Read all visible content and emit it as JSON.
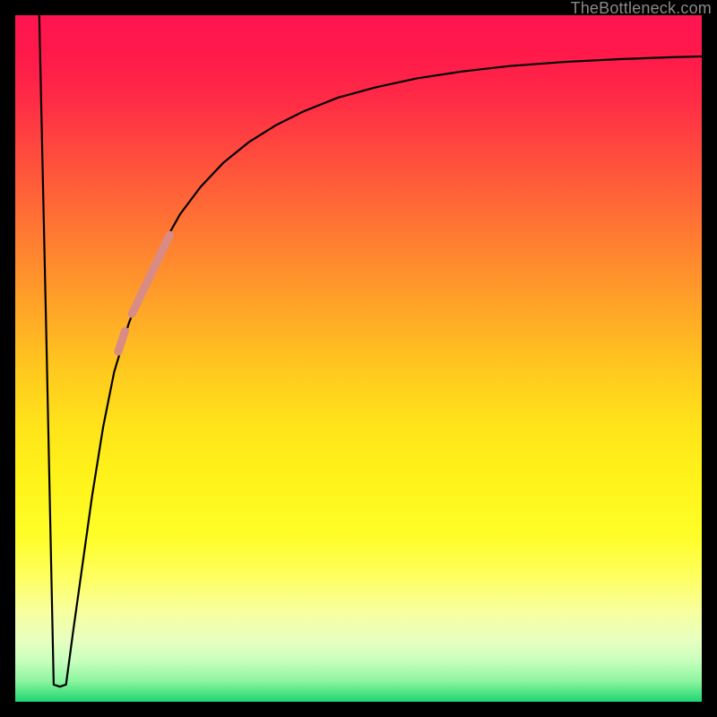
{
  "attribution": "TheBottleneck.com",
  "colors": {
    "frame": "#000000",
    "curve_stroke": "#000000",
    "highlight_stroke": "#d98b86",
    "attribution_text": "#8a8a8a"
  },
  "chart_data": {
    "type": "line",
    "title": "",
    "xlabel": "",
    "ylabel": "",
    "xlim": [
      0,
      100
    ],
    "ylim": [
      0,
      100
    ],
    "grid": false,
    "legend": false,
    "series": [
      {
        "name": "curve",
        "x": [
          3.5,
          4.6,
          5.6,
          6.5,
          7.4,
          8.4,
          9.8,
          11.2,
          12.8,
          14.4,
          16.5,
          18.8,
          21.2,
          24.0,
          27.0,
          30.3,
          34.0,
          38.0,
          42.0,
          47.0,
          52.5,
          58.5,
          65.0,
          72.0,
          80.0,
          88.0,
          96.0,
          100.0
        ],
        "y": [
          100.0,
          50.0,
          2.5,
          2.2,
          2.5,
          10.0,
          20.0,
          30.0,
          40.0,
          48.0,
          55.0,
          61.0,
          66.0,
          71.0,
          75.0,
          78.5,
          81.5,
          84.0,
          86.0,
          88.0,
          89.5,
          90.8,
          91.8,
          92.6,
          93.2,
          93.6,
          93.9,
          94.0
        ]
      }
    ],
    "highlight_segments": [
      {
        "x_start": 17.0,
        "y_start": 56.5,
        "x_end": 22.5,
        "y_end": 68.0
      },
      {
        "x_start": 15.0,
        "y_start": 51.0,
        "x_end": 16.0,
        "y_end": 54.0
      }
    ]
  }
}
